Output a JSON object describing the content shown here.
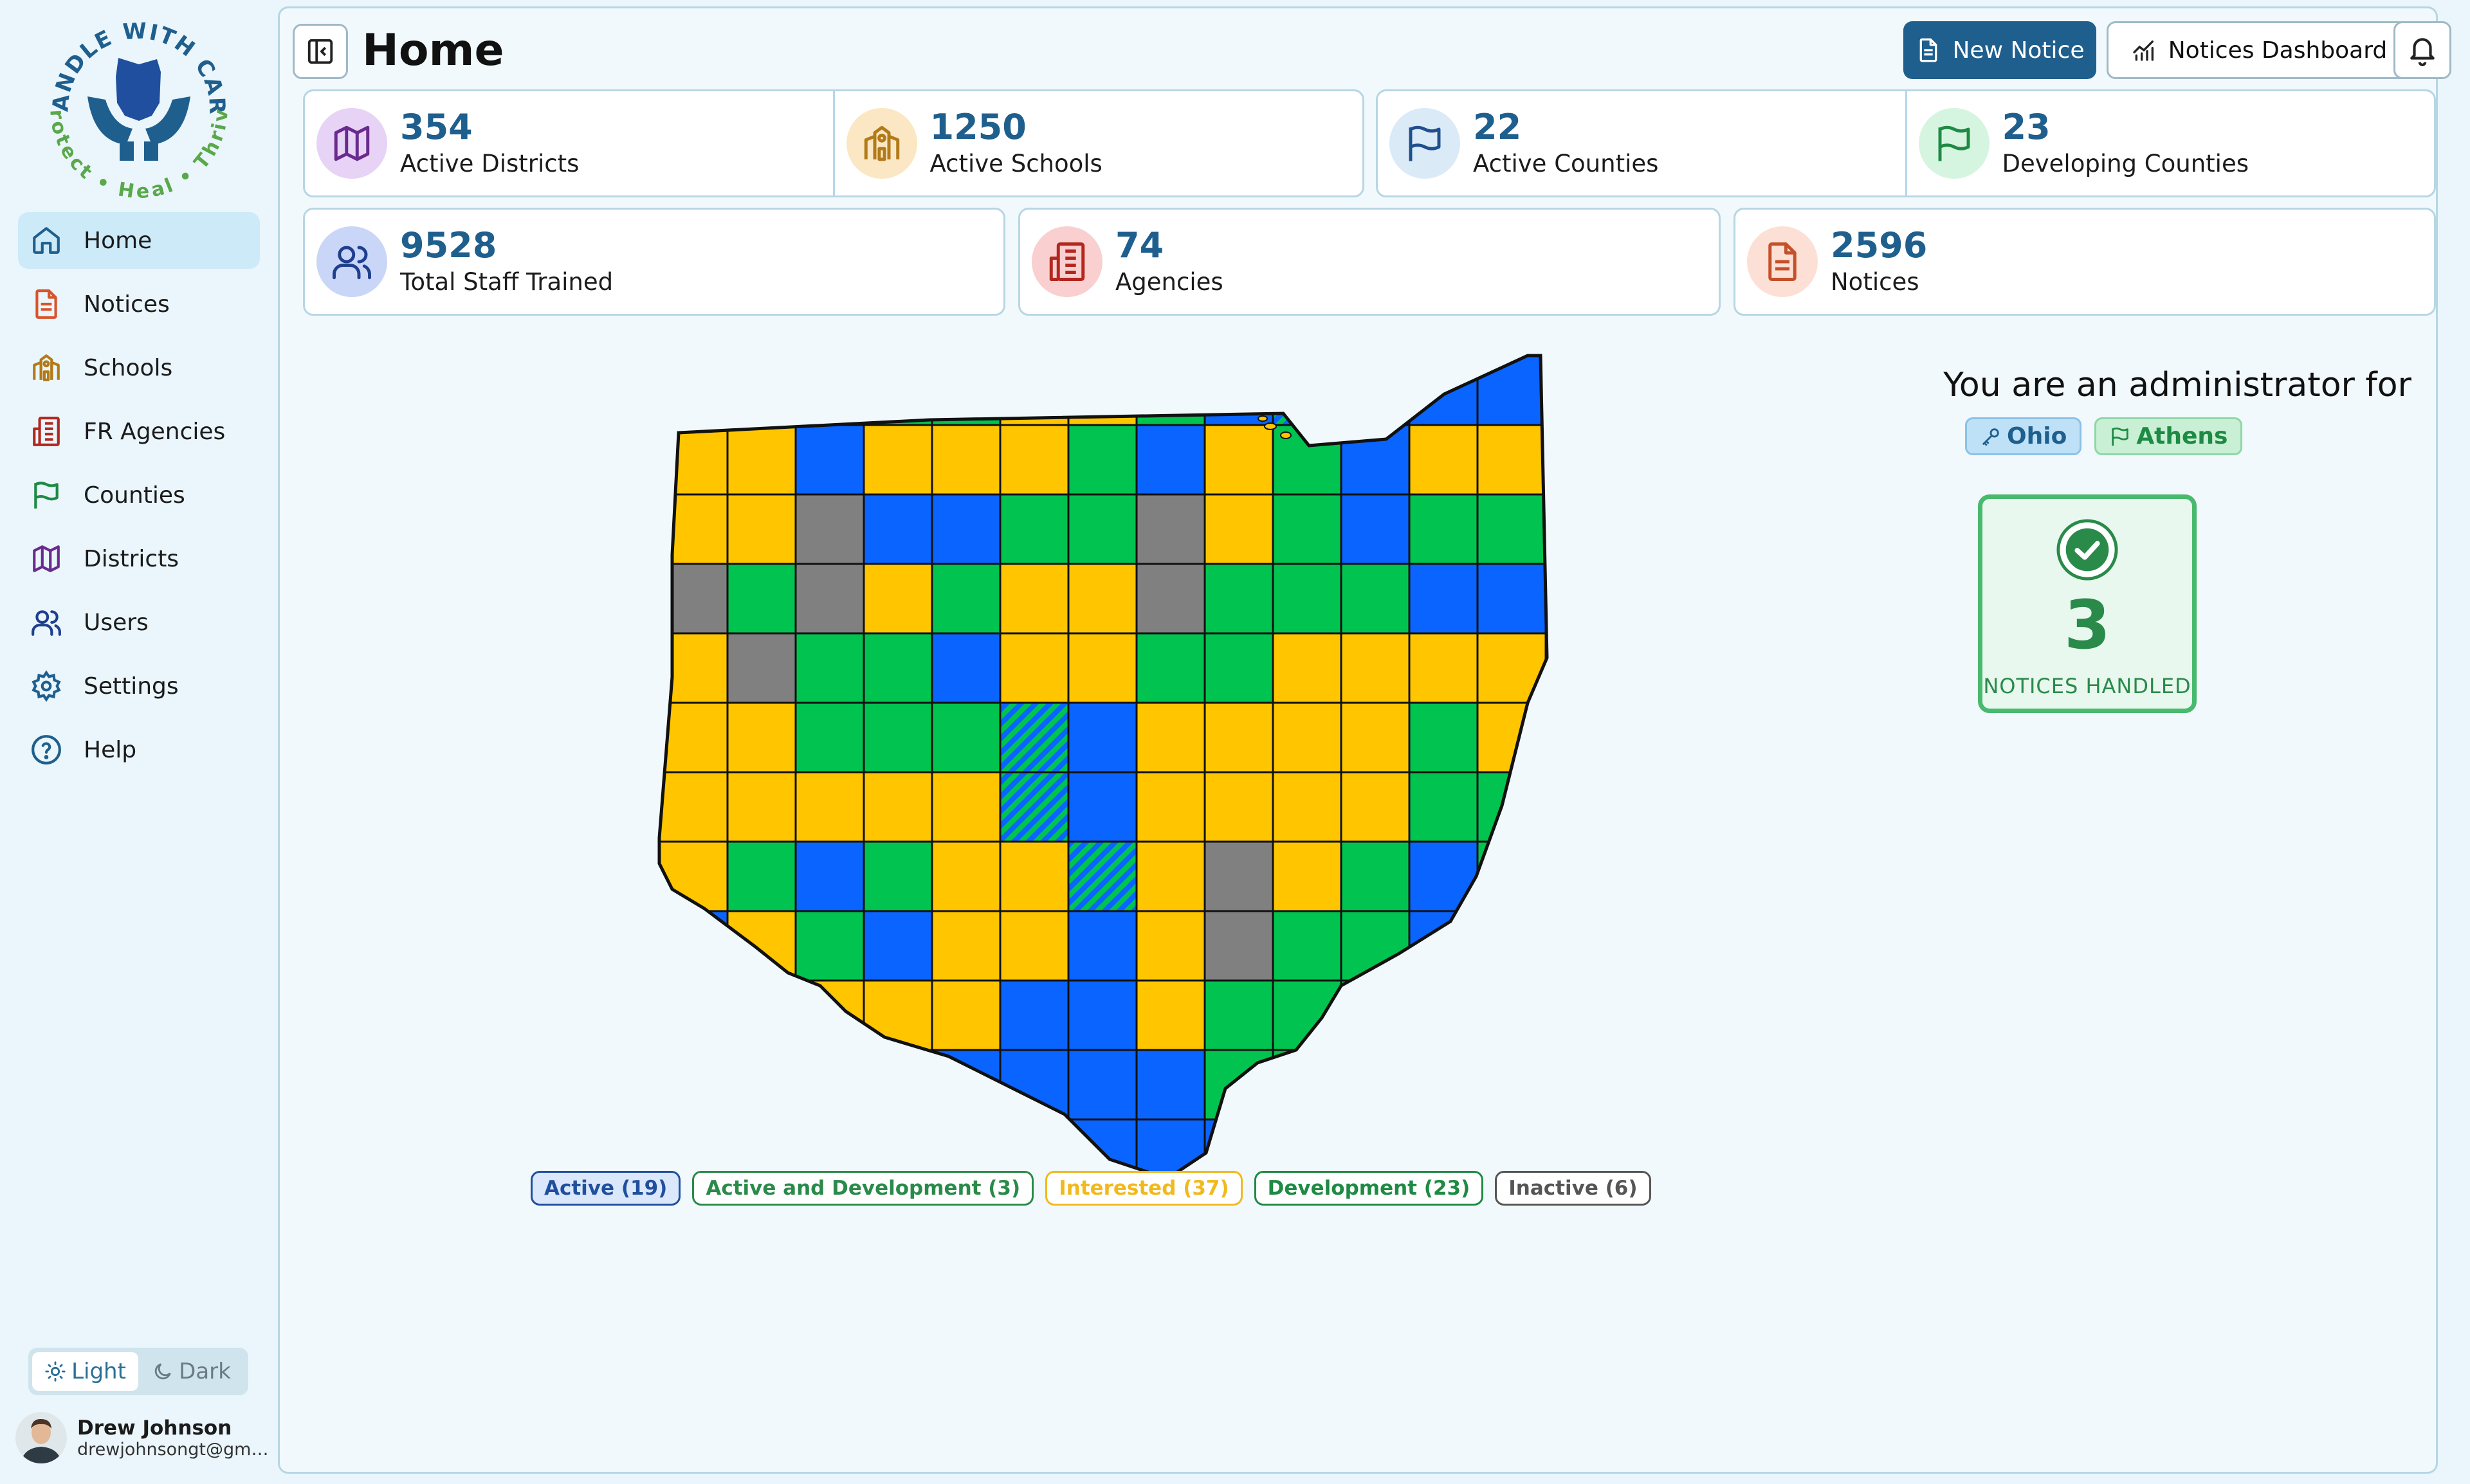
{
  "logo": {
    "arc_top": "HANDLE WITH CARE",
    "arc_bottom": "Protect • Heal • Thrive"
  },
  "sidebar": {
    "items": [
      {
        "label": "Home",
        "icon": "home-icon",
        "active": true
      },
      {
        "label": "Notices",
        "icon": "document-icon"
      },
      {
        "label": "Schools",
        "icon": "school-icon"
      },
      {
        "label": "FR Agencies",
        "icon": "building-icon"
      },
      {
        "label": "Counties",
        "icon": "flag-icon"
      },
      {
        "label": "Districts",
        "icon": "map-icon"
      },
      {
        "label": "Users",
        "icon": "users-icon"
      },
      {
        "label": "Settings",
        "icon": "gear-icon"
      },
      {
        "label": "Help",
        "icon": "help-icon"
      }
    ],
    "theme": {
      "light": "Light",
      "dark": "Dark",
      "selected": "Light"
    },
    "user": {
      "name": "Drew Johnson",
      "email": "drewjohnsongt@gmail..."
    }
  },
  "header": {
    "title": "Home",
    "new_notice": "New Notice",
    "notices_dashboard": "Notices Dashboard"
  },
  "stats_row1": [
    {
      "value": "354",
      "label": "Active Districts",
      "icon": "map-icon",
      "bg": "#e6d3f5",
      "fg": "#6a2a8f"
    },
    {
      "value": "1250",
      "label": "Active Schools",
      "icon": "school-icon",
      "bg": "#fbe7c3",
      "fg": "#b37a19"
    },
    {
      "value": "22",
      "label": "Active Counties",
      "icon": "flag-icon",
      "bg": "#dbeaf7",
      "fg": "#1f4f8e"
    },
    {
      "value": "23",
      "label": "Developing Counties",
      "icon": "flag-icon",
      "bg": "#d6f5e0",
      "fg": "#1e8a44"
    }
  ],
  "stats_row2": [
    {
      "value": "9528",
      "label": "Total Staff Trained",
      "icon": "users-icon",
      "bg": "#c9d6f7",
      "fg": "#1f3f8e"
    },
    {
      "value": "74",
      "label": "Agencies",
      "icon": "building-icon",
      "bg": "#f9cfcf",
      "fg": "#b3261e"
    },
    {
      "value": "2596",
      "label": "Notices",
      "icon": "document-icon",
      "bg": "#fde0d5",
      "fg": "#c4502a"
    }
  ],
  "legend": [
    {
      "label": "Active (19)",
      "color": "#1f4f9e",
      "bg": "#dbe8fb"
    },
    {
      "label": "Active and Development (3)",
      "color": "#2a8a4a",
      "bg": "#ffffff"
    },
    {
      "label": "Interested (37)",
      "color": "#f2b91c",
      "bg": "#ffffff"
    },
    {
      "label": "Development (23)",
      "color": "#1e8a44",
      "bg": "#ffffff"
    },
    {
      "label": "Inactive (6)",
      "color": "#555555",
      "bg": "#ffffff"
    }
  ],
  "map_colors": {
    "active": "#0a64ff",
    "interested": "#ffc600",
    "development": "#00c44f",
    "inactive": "#808080"
  },
  "admin": {
    "title": "You are an administrator for",
    "tags": [
      {
        "label": "Ohio",
        "icon": "key-icon"
      },
      {
        "label": "Athens",
        "icon": "flag-icon"
      }
    ],
    "notices_handled": {
      "value": "3",
      "label": "NOTICES HANDLED"
    }
  }
}
